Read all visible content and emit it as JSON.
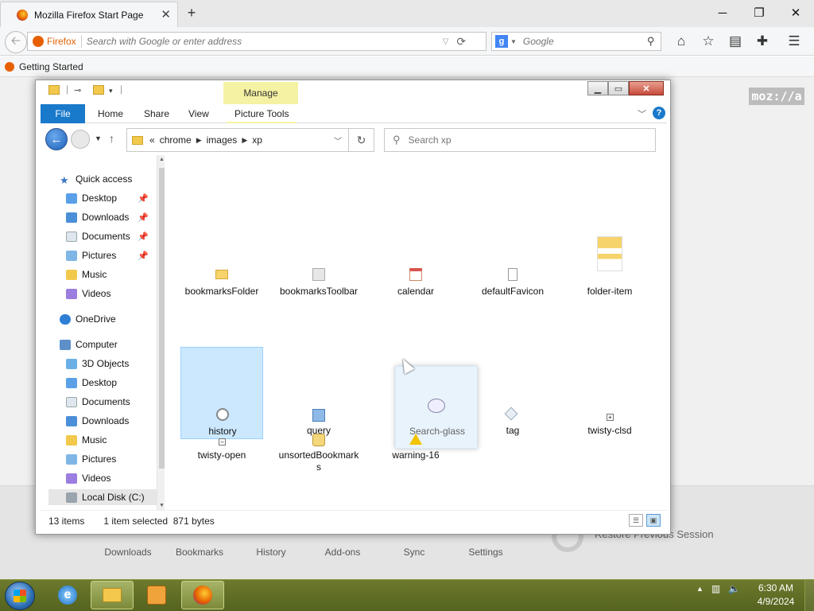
{
  "firefox": {
    "tab_title": "Mozilla Firefox Start Page",
    "new_tab": "+",
    "window_buttons": {
      "minimize": "─",
      "maximize": "❐",
      "close": "✕"
    },
    "url_label": "Firefox",
    "url_placeholder": "Search with Google or enter address",
    "search_engine_letter": "g",
    "search_placeholder": "Google",
    "bookmark": "Getting Started",
    "mozilla_logo": "moz://a",
    "launch_items": [
      "Downloads",
      "Bookmarks",
      "History",
      "Add-ons",
      "Sync",
      "Settings"
    ],
    "restore_session": "Restore Previous Session"
  },
  "explorer": {
    "manage_tab": "Manage",
    "ribbon_tabs": [
      "File",
      "Home",
      "Share",
      "View",
      "Picture Tools"
    ],
    "breadcrumb_prefix": "«",
    "breadcrumb": [
      "chrome",
      "images",
      "xp"
    ],
    "search_placeholder": "Search xp",
    "nav": {
      "quick_access": "Quick access",
      "quick_items": [
        "Desktop",
        "Downloads",
        "Documents",
        "Pictures",
        "Music",
        "Videos"
      ],
      "onedrive": "OneDrive",
      "computer": "Computer",
      "computer_items": [
        "3D Objects",
        "Desktop",
        "Documents",
        "Downloads",
        "Music",
        "Pictures",
        "Videos",
        "Local Disk (C:)"
      ]
    },
    "files": [
      {
        "name": "bookmarksFolder"
      },
      {
        "name": "bookmarksToolbar"
      },
      {
        "name": "calendar"
      },
      {
        "name": "defaultFavicon"
      },
      {
        "name": "folder-item"
      },
      {
        "name": "history"
      },
      {
        "name": "query"
      },
      {
        "name": "Search-glass"
      },
      {
        "name": "tag"
      },
      {
        "name": "twisty-clsd"
      },
      {
        "name": "twisty-open"
      },
      {
        "name": "unsortedBookmarks"
      },
      {
        "name": "warning-16"
      }
    ],
    "status_items": "13 items",
    "status_selected": "1 item selected  871 bytes"
  },
  "taskbar": {
    "time": "6:30 AM",
    "date": "4/9/2024"
  },
  "colors": {
    "taskbar": "#5f6d25",
    "file_tab": "#1979ca",
    "manage_tab": "#f5f2a4",
    "selection": "#cce8ff"
  }
}
